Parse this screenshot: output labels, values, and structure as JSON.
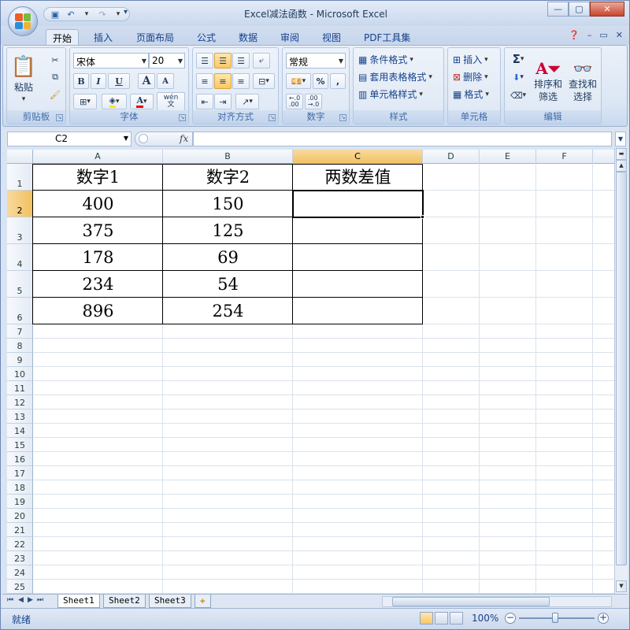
{
  "window": {
    "title": "Excel减法函数 - Microsoft Excel",
    "controls": {
      "minimize": "—",
      "restore": "▢",
      "close": "✕"
    }
  },
  "qat": {
    "items": [
      "save-icon",
      "undo-icon",
      "redo-icon",
      "customize-icon"
    ]
  },
  "tabs": [
    "开始",
    "插入",
    "页面布局",
    "公式",
    "数据",
    "审阅",
    "视图",
    "PDF工具集"
  ],
  "active_tab": "开始",
  "ribbon": {
    "clipboard": {
      "label": "剪贴板",
      "paste": "粘贴"
    },
    "font": {
      "label": "字体",
      "font_name": "宋体",
      "font_size": "20",
      "bold": "B",
      "italic": "I",
      "underline": "U",
      "grow": "A",
      "shrink": "A",
      "wen": "wén\n文"
    },
    "alignment": {
      "label": "对齐方式"
    },
    "number": {
      "label": "数字",
      "format": "常规",
      "percent": "%",
      "comma": ",",
      "inc_dec": "←.0\n.00",
      "dec_dec": ".00\n→.0"
    },
    "styles": {
      "label": "样式",
      "conditional": "条件格式",
      "table": "套用表格格式",
      "cell_style": "单元格样式"
    },
    "cells": {
      "label": "单元格",
      "insert": "插入",
      "delete": "删除",
      "format": "格式"
    },
    "editing": {
      "label": "编辑",
      "sum": "Σ",
      "sort": "排序和\n筛选",
      "find": "查找和\n选择"
    }
  },
  "formula_bar": {
    "name_box": "C2",
    "fx": "fx",
    "formula": ""
  },
  "columns": [
    "A",
    "B",
    "C",
    "D",
    "E",
    "F"
  ],
  "active_column": "C",
  "rows": [
    "1",
    "2",
    "3",
    "4",
    "5",
    "6",
    "7",
    "8",
    "9",
    "10",
    "11",
    "12",
    "13",
    "14",
    "15",
    "16",
    "17",
    "18",
    "19",
    "20",
    "21",
    "22",
    "23",
    "24",
    "25"
  ],
  "active_row": "2",
  "table": {
    "headers": [
      "数字1",
      "数字2",
      "两数差值"
    ],
    "rows": [
      [
        "400",
        "150",
        ""
      ],
      [
        "375",
        "125",
        ""
      ],
      [
        "178",
        "69",
        ""
      ],
      [
        "234",
        "54",
        ""
      ],
      [
        "896",
        "254",
        ""
      ]
    ]
  },
  "sheets": [
    "Sheet1",
    "Sheet2",
    "Sheet3"
  ],
  "active_sheet": "Sheet1",
  "status": {
    "text": "就绪",
    "zoom": "100%"
  }
}
